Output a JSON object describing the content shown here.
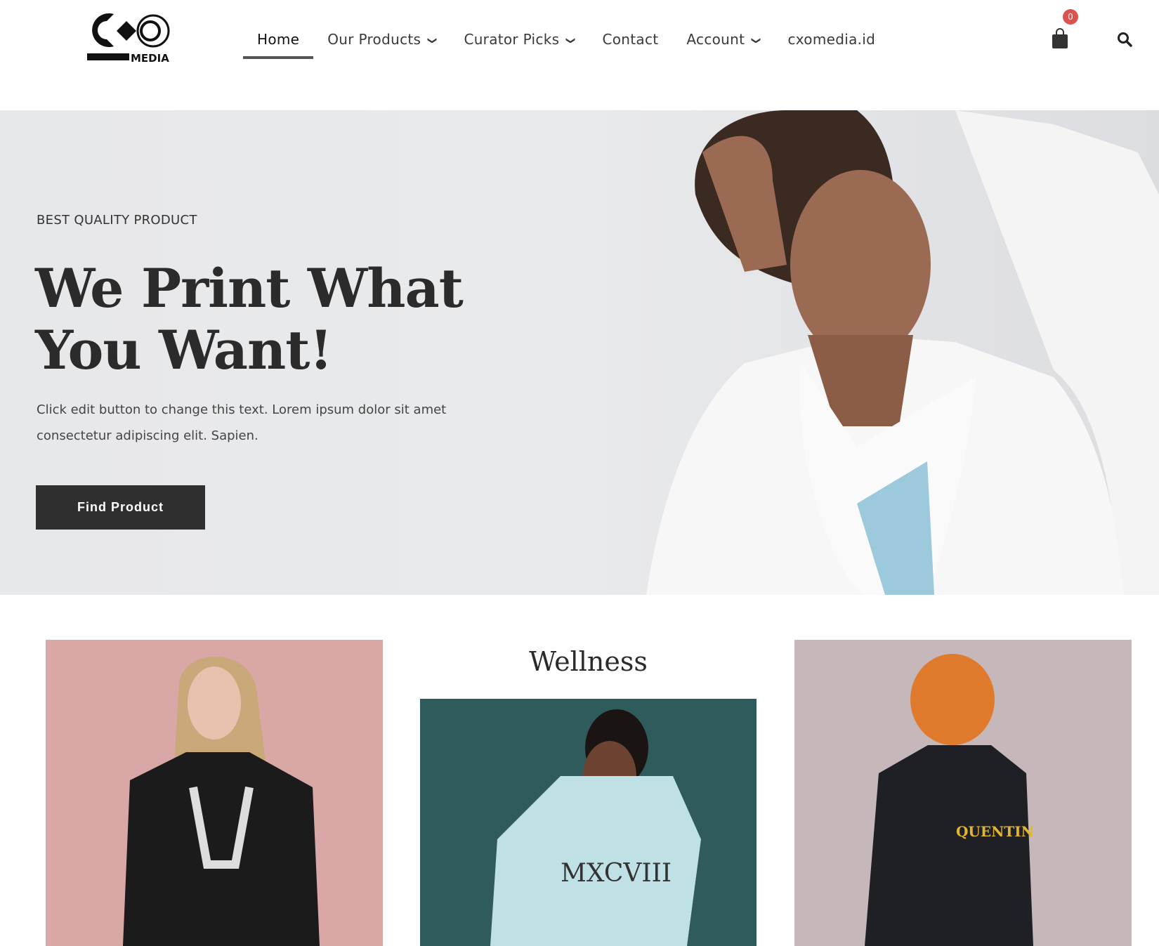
{
  "header": {
    "logo_text": "MEDIA",
    "nav": [
      {
        "label": "Home",
        "active": true,
        "dropdown": false
      },
      {
        "label": "Our Products",
        "dropdown": true
      },
      {
        "label": "Curator Picks",
        "dropdown": true
      },
      {
        "label": "Contact",
        "dropdown": false
      },
      {
        "label": "Account",
        "dropdown": true
      },
      {
        "label": "cxomedia.id",
        "dropdown": false
      }
    ],
    "cart_count": "0",
    "cart_icon": "shopping-bag-icon",
    "search_icon": "search-icon"
  },
  "hero": {
    "eyebrow": "BEST QUALITY PRODUCT",
    "headline_line1": "We Print What",
    "headline_line2": "You Want!",
    "body": "Click edit button to change this text. Lorem ipsum dolor sit amet consectetur adipiscing elit. Sapien.",
    "button": "Find Product"
  },
  "products": {
    "center_title": "Wellness"
  },
  "colors": {
    "badge": "#d9534f",
    "button": "#2f2f2f",
    "hero_bg": "#e8e9eb"
  }
}
